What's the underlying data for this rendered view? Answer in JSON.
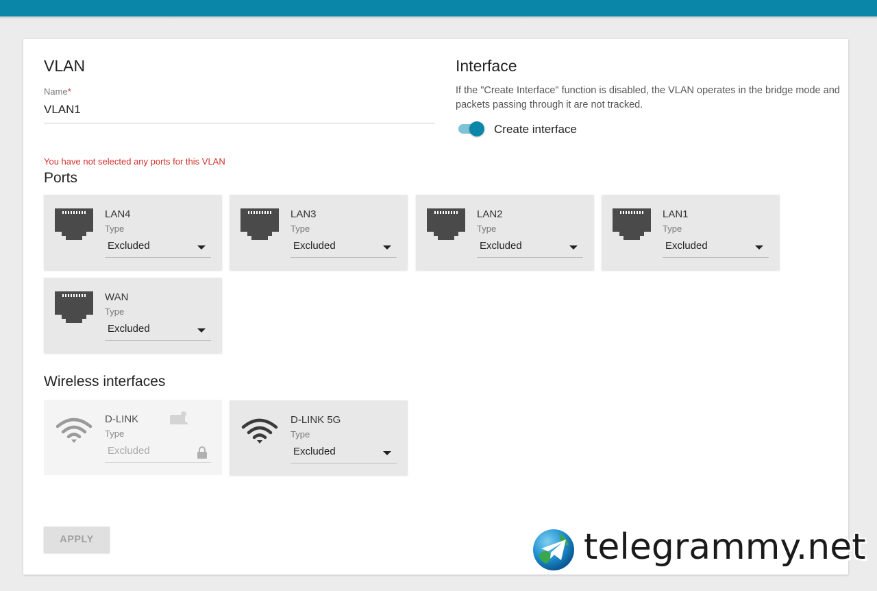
{
  "colors": {
    "accent": "#0a87a8",
    "error": "#d0312d",
    "card_bg": "#e8e8e8",
    "page_bg": "#ececec"
  },
  "vlan": {
    "title": "VLAN",
    "name_label": "Name",
    "required_mark": "*",
    "name_value": "VLAN1"
  },
  "interface": {
    "title": "Interface",
    "description": "If the \"Create Interface\" function is disabled, the VLAN operates in the bridge mode and packets passing through it are not tracked.",
    "toggle_label": "Create interface",
    "toggle_on": true
  },
  "ports": {
    "warning": "You have not selected any ports for this VLAN",
    "title": "Ports",
    "items": [
      {
        "name": "LAN4",
        "type_label": "Type",
        "value": "Excluded",
        "icon": "ethernet-port-icon"
      },
      {
        "name": "LAN3",
        "type_label": "Type",
        "value": "Excluded",
        "icon": "ethernet-port-icon"
      },
      {
        "name": "LAN2",
        "type_label": "Type",
        "value": "Excluded",
        "icon": "ethernet-port-icon"
      },
      {
        "name": "LAN1",
        "type_label": "Type",
        "value": "Excluded",
        "icon": "ethernet-port-icon"
      },
      {
        "name": "WAN",
        "type_label": "Type",
        "value": "Excluded",
        "icon": "ethernet-port-icon"
      }
    ]
  },
  "wireless": {
    "title": "Wireless interfaces",
    "items": [
      {
        "name": "D-LINK",
        "type_label": "Type",
        "value": "Excluded",
        "icon": "wifi-icon",
        "disabled": true
      },
      {
        "name": "D-LINK 5G",
        "type_label": "Type",
        "value": "Excluded",
        "icon": "wifi-icon",
        "disabled": false
      }
    ]
  },
  "apply_label": "APPLY",
  "watermark": {
    "text": "telegrammy.net",
    "icon": "telegram-globe-icon"
  }
}
